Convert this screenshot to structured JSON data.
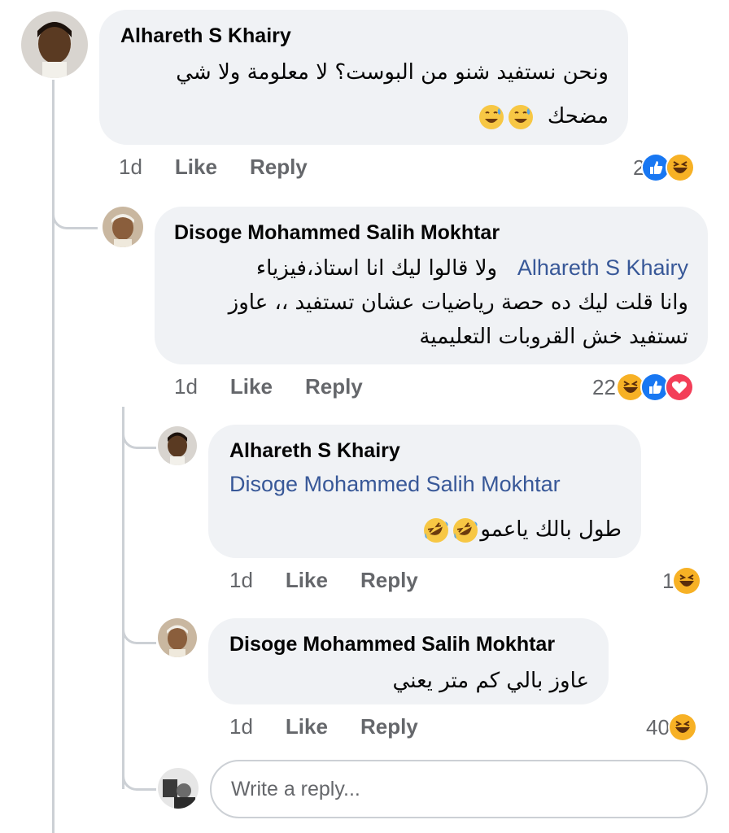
{
  "comments": [
    {
      "author": "Alhareth S Khairy",
      "lines": [
        "ونحن نستفيد شنو  من البوست؟ لا معلومة ولا شي",
        "مضحك"
      ],
      "time": "1d",
      "like": "Like",
      "reply": "Reply",
      "reaction_count": "2",
      "reactions": [
        "like-icon",
        "haha-icon"
      ]
    },
    {
      "author": "Disoge Mohammed Salih Mokhtar",
      "mention": "Alhareth S Khairy",
      "lines": [
        "ولا قالوا ليك انا استاذ،فيزياء",
        "وانا قلت ليك ده حصة رياضيات عشان تستفيد ،، عاوز",
        "تستفيد خش القروبات التعليمية"
      ],
      "time": "1d",
      "like": "Like",
      "reply": "Reply",
      "reaction_count": "22",
      "reactions": [
        "haha-icon",
        "like-icon",
        "love-icon"
      ]
    },
    {
      "author": "Alhareth S Khairy",
      "mention": "Disoge Mohammed Salih Mokhtar",
      "lines": [
        "طول بالك ياعمو"
      ],
      "time": "1d",
      "like": "Like",
      "reply": "Reply",
      "reaction_count": "1",
      "reactions": [
        "haha-icon"
      ]
    },
    {
      "author": "Disoge Mohammed Salih Mokhtar",
      "lines": [
        "عاوز بالي كم متر يعني"
      ],
      "time": "1d",
      "like": "Like",
      "reply": "Reply",
      "reaction_count": "40",
      "reactions": [
        "haha-icon"
      ]
    }
  ],
  "reply_input": {
    "placeholder": "Write a reply..."
  },
  "colors": {
    "bubble": "#f0f2f5",
    "mention": "#385898",
    "meta": "#65676b",
    "like_blue": "#1877f2",
    "love_red": "#f33e58",
    "haha_yellow": "#f7b125"
  }
}
